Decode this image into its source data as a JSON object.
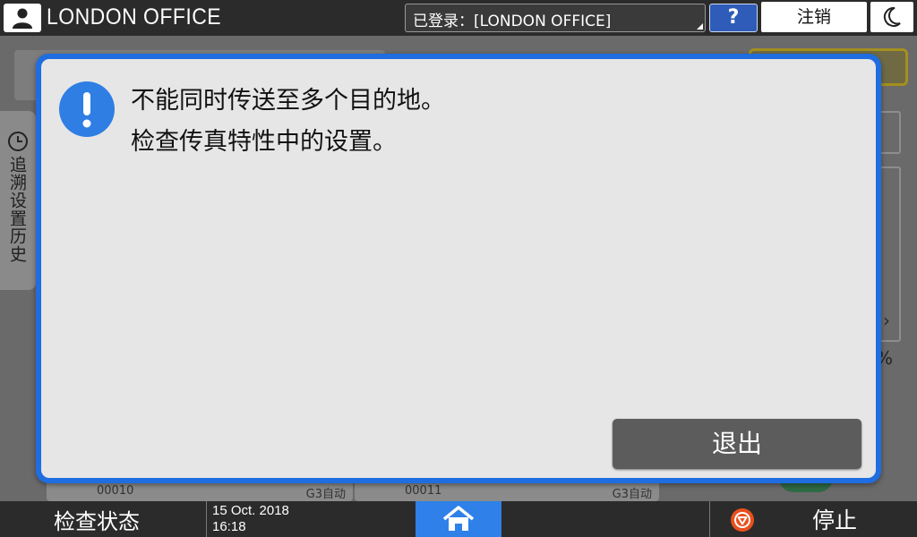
{
  "header": {
    "office_name": "LONDON OFFICE",
    "login_status": "已登录：[LONDON OFFICE]",
    "help_label": "?",
    "logout_label": "注销"
  },
  "background": {
    "history_tab_label": "追溯设置历史",
    "percent_fragment": "%",
    "jobs": [
      {
        "number": "00010",
        "mode": "G3自动"
      },
      {
        "number": "00011",
        "mode": "G3自动"
      }
    ]
  },
  "dialog": {
    "message_line1": "不能同时传送至多个目的地。",
    "message_line2": "检查传真特性中的设置。",
    "exit_label": "退出"
  },
  "footer": {
    "check_status_label": "检查状态",
    "date": "15 Oct. 2018",
    "time": "16:18",
    "stop_label": "停止"
  },
  "colors": {
    "dialog_border": "#1f6de0",
    "alert_icon": "#2f7ee3",
    "home_button": "#2f80e8",
    "help_button": "#2e5cb8",
    "stop_icon": "#e8501e"
  }
}
